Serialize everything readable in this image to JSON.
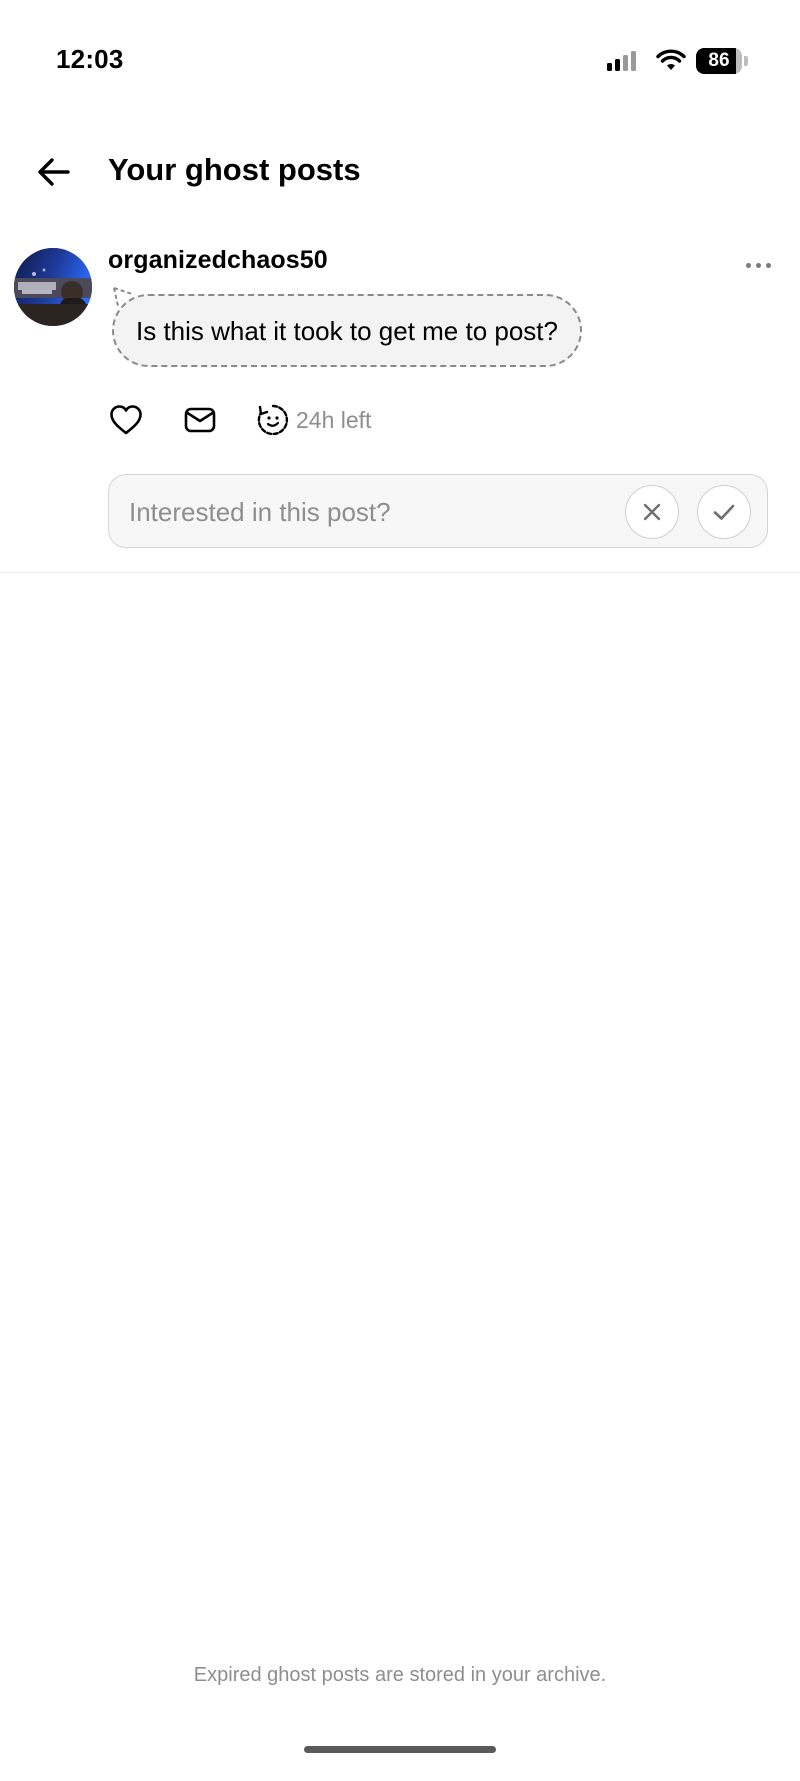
{
  "status_bar": {
    "time": "12:03",
    "battery_level": "86",
    "battery_fraction": 0.86
  },
  "header": {
    "back_icon": "arrow-left-icon",
    "title": "Your ghost posts"
  },
  "post": {
    "username": "organizedchaos50",
    "text": "Is this what it took to get me to post?",
    "time_left": "24h left",
    "interest_prompt": "Interested in this post?",
    "icons": {
      "like": "heart-icon",
      "message": "envelope-icon",
      "ghost": "ghost-timer-icon",
      "more": "ellipsis-icon",
      "dismiss": "close-icon",
      "confirm": "check-icon"
    }
  },
  "footer": {
    "note": "Expired ghost posts are stored in your archive."
  },
  "colors": {
    "muted_text": "#8e8e8e",
    "bubble_bg": "#f3f3f3",
    "bubble_border": "#8a8a8a",
    "divider": "#ececec"
  }
}
